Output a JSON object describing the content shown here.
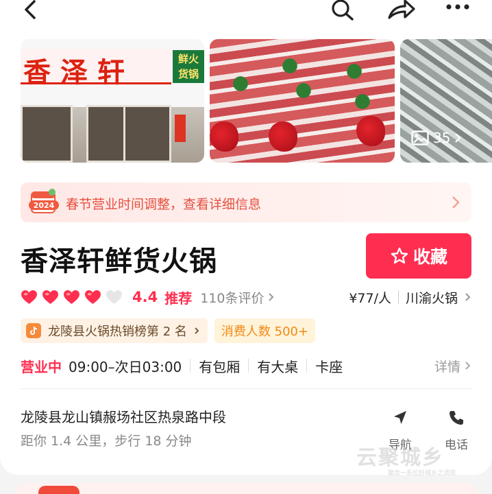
{
  "header": {
    "back_icon": "back-arrow-icon",
    "action_icons": [
      "search-icon",
      "share-icon",
      "more-icon"
    ]
  },
  "gallery": {
    "storefront_sign": "香泽轩",
    "storefront_side_sign": "鲜火\n货锅",
    "photo_count": "35"
  },
  "notice": {
    "badge_year": "2024",
    "text": "春节营业时间调整，查看详细信息"
  },
  "shop": {
    "name": "香泽轩鲜货火锅",
    "favorite_label": "收藏",
    "rating_hearts": 4,
    "rating_hearts_total": 5,
    "score": "4.4",
    "recommend": "推荐",
    "reviews": "110条评价",
    "price": "¥77/人",
    "category": "川渝火锅"
  },
  "tags": {
    "rank": "龙陵县火锅热销榜第 2 名",
    "consumers": "消费人数 500+"
  },
  "hours": {
    "status": "营业中",
    "time": "09:00–次日03:00",
    "features": [
      "有包厢",
      "有大桌",
      "卡座"
    ],
    "detail": "详情"
  },
  "location": {
    "address": "龙陵县龙山镇赧场社区热泉路中段",
    "distance": "距你 1.4 公里，步行 18 分钟",
    "nav_label": "导航",
    "call_label": "电话"
  },
  "watermark": {
    "main": "云聚城乡",
    "sub": "聚合一系位好城乡之流视"
  },
  "colors": {
    "accent": "#ff2e50",
    "notice_text": "#e5503f",
    "consumer_tag": "#f08a13"
  }
}
